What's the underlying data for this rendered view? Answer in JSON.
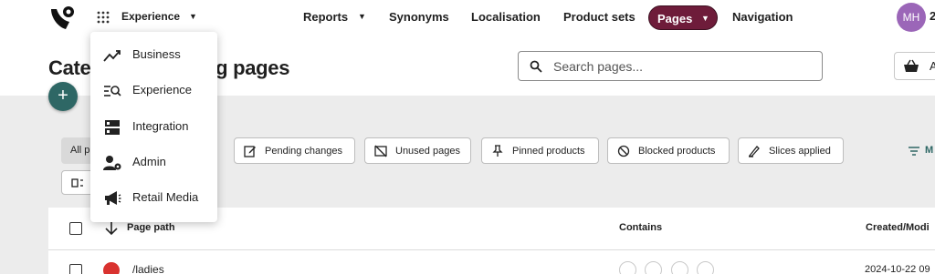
{
  "header": {
    "switcher_label": "Experience",
    "nav": [
      {
        "label": "Reports",
        "has_caret": true
      },
      {
        "label": "Synonyms"
      },
      {
        "label": "Localisation"
      },
      {
        "label": "Product sets"
      },
      {
        "label": "Pages",
        "has_caret": true,
        "active": true
      },
      {
        "label": "Navigation"
      }
    ],
    "avatar_initials": "MH",
    "avatar_extra": "2",
    "accent_color": "#6e1c3a",
    "avatar_color": "#9b66b8"
  },
  "page": {
    "title": "Category & landing pages",
    "search_placeholder": "Search pages...",
    "basket_label": "A"
  },
  "product_menu": {
    "items": [
      {
        "label": "Business",
        "icon": "trending-icon"
      },
      {
        "label": "Experience",
        "icon": "list-search-icon"
      },
      {
        "label": "Integration",
        "icon": "server-icon"
      },
      {
        "label": "Admin",
        "icon": "users-cog-icon"
      },
      {
        "label": "Retail Media",
        "icon": "megaphone-icon"
      }
    ]
  },
  "filters": {
    "all_label": "All p",
    "chips": [
      {
        "label": "Pending changes",
        "icon": "edit-icon"
      },
      {
        "label": "Unused pages",
        "icon": "unused-pages-icon"
      },
      {
        "label": "Pinned products",
        "icon": "pin-icon"
      },
      {
        "label": "Blocked products",
        "icon": "blocked-icon"
      },
      {
        "label": "Slices applied",
        "icon": "slice-icon"
      }
    ],
    "more_label": "M"
  },
  "table": {
    "columns": [
      "Page path",
      "Contains",
      "Created/Modi"
    ],
    "rows": [
      {
        "path": "/ladies",
        "date": "2024-10-22 09"
      }
    ]
  }
}
